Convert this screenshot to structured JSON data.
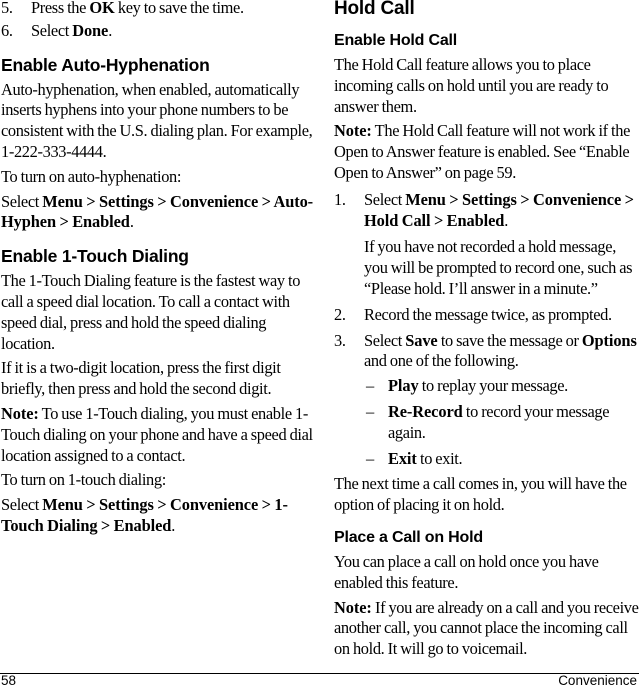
{
  "left_column": {
    "top_steps": [
      {
        "num": "5.",
        "pre": "Press the ",
        "bold": "OK",
        "post": " key to save the time."
      },
      {
        "num": "6.",
        "pre": "Select ",
        "bold": "Done",
        "post": "."
      }
    ],
    "auto_hyphen": {
      "heading": "Enable Auto-Hyphenation",
      "para1": "Auto-hyphenation, when enabled, automatically inserts hyphens into your phone numbers to be consistent with the U.S. dialing plan. For example, 1-222-333-4444.",
      "para2": "To turn on auto-hyphenation:",
      "select_pre": "Select ",
      "select_path": "Menu > Settings > Convenience > Auto-Hyphen > Enabled",
      "select_post": "."
    },
    "one_touch": {
      "heading": "Enable 1-Touch Dialing",
      "para1": "The 1-Touch Dialing feature is the fastest way to call a speed dial location. To call a contact with speed dial, press and hold the speed dialing location.",
      "para2": "If it is a two-digit location, press the first digit briefly, then press and hold the second digit.",
      "note_label": "Note:",
      "note_text": " To use 1-Touch dialing, you must enable 1-Touch dialing on your phone and have a speed dial location assigned to a contact.",
      "para3": "To turn on 1-touch dialing:",
      "select_pre": "Select ",
      "select_path": "Menu > Settings > Convenience > 1-Touch Dialing > Enabled",
      "select_post": "."
    }
  },
  "right_column": {
    "heading": "Hold Call",
    "enable": {
      "heading": "Enable Hold Call",
      "para1": "The Hold Call feature allows you to place incoming calls on hold until you are ready to answer them.",
      "note_label": "Note:",
      "note_text": " The Hold Call feature will not work if the Open to Answer feature is enabled. See “Enable Open to Answer” on page 59.",
      "steps": [
        {
          "num": "1.",
          "pre": "Select ",
          "bold": "Menu > Settings > Convenience > Hold Call > Enabled",
          "post": ".",
          "sub": "If you have not recorded a hold message, you will be prompted to record one, such as “Please hold. I’ll answer in a minute.”"
        },
        {
          "num": "2.",
          "text": "Record the message twice, as prompted."
        },
        {
          "num": "3.",
          "pre": "Select ",
          "bold1": "Save",
          "mid": " to save the message or ",
          "bold2": "Options",
          "post": " and one of the following.",
          "options": [
            {
              "dash": "–",
              "bold": "Play",
              "text": " to replay your message."
            },
            {
              "dash": "–",
              "bold": "Re-Record",
              "text": " to record your message again."
            },
            {
              "dash": "–",
              "bold": "Exit",
              "text": " to exit."
            }
          ]
        }
      ],
      "closing": "The next time a call comes in, you will have the option of placing it on hold."
    },
    "place": {
      "heading": "Place a Call on Hold",
      "para1": "You can place a call on hold once you have enabled this feature.",
      "note_label": "Note:",
      "note_text": " If you are already on a call and you receive another call, you cannot place the incoming call on hold. It will go to voicemail."
    }
  },
  "footer": {
    "page_number": "58",
    "chapter": "Convenience"
  }
}
